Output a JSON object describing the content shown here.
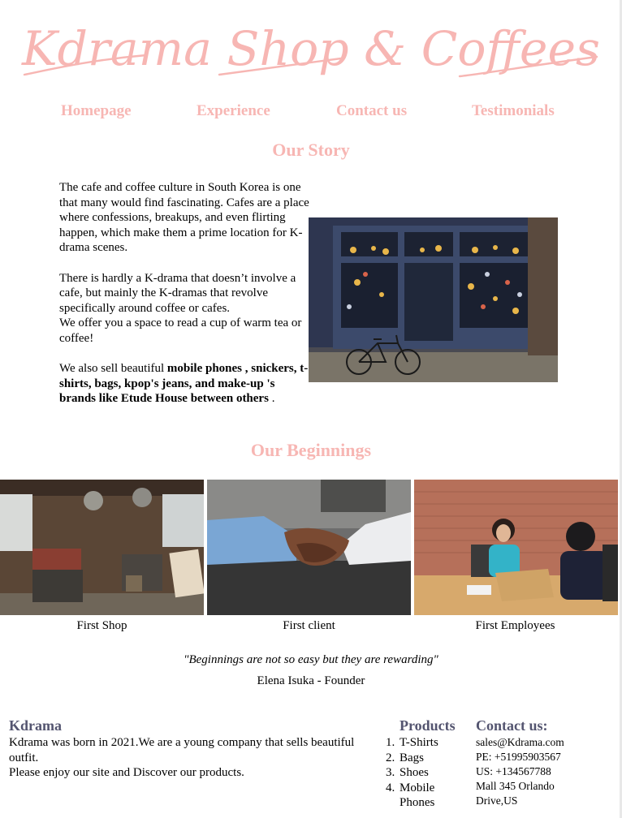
{
  "brand": {
    "logo_text": "Kdrama Shop & Coffees",
    "accent_color": "#f7b6b3",
    "footer_heading_color": "#545570"
  },
  "nav": {
    "items": [
      {
        "label": "Homepage"
      },
      {
        "label": "Experience"
      },
      {
        "label": "Contact us"
      },
      {
        "label": "Testimonials"
      }
    ]
  },
  "story": {
    "heading": "Our Story",
    "p1": "The cafe and coffee culture in South Korea is one that many would find fascinating. Cafes are a place where confessions, breakups, and even flirting happen, which make them a prime location for K-drama scenes.",
    "p2": "There is hardly a K-drama that doesn’t involve a cafe, but mainly the K-dramas that revolve specifically around coffee or cafes.",
    "p3": "We offer you a space to read a cup of warm tea or coffee!",
    "p4_prefix": "We also sell beautiful ",
    "p4_bold": "mobile phones , snickers, t-shirts, bags, kpop's jeans, and make-up 's brands like Etude House between others",
    "p4_suffix": " .",
    "image_icon": "cafe-storefront-photo"
  },
  "beginnings": {
    "heading": "Our Beginnings",
    "items": [
      {
        "caption": "First Shop",
        "icon": "workshop-photo"
      },
      {
        "caption": "First client",
        "icon": "handshake-photo"
      },
      {
        "caption": "First Employees",
        "icon": "meeting-photo"
      }
    ],
    "quote": "Beginnings are not so easy but they are rewarding",
    "quote_open": "\"",
    "quote_close": "\"",
    "author": "Elena Isuka - Founder"
  },
  "footer": {
    "about_title": "Kdrama",
    "about_text1": "Kdrama was born in 2021.We are a young company that sells beautiful outfit.",
    "about_text2": "Please enjoy our site and Discover our products.",
    "products_title": "Products",
    "products": [
      {
        "num": "1.",
        "label": "T-Shirts"
      },
      {
        "num": "2.",
        "label": "Bags"
      },
      {
        "num": "3.",
        "label": "Shoes"
      },
      {
        "num": "4.",
        "label": "Mobile Phones"
      }
    ],
    "contact_title": "Contact us:",
    "contact": {
      "email": "sales@Kdrama.com",
      "pe": "PE: +51995903567",
      "us": "US: +134567788",
      "address": "Mall 345 Orlando Drive,US"
    }
  }
}
